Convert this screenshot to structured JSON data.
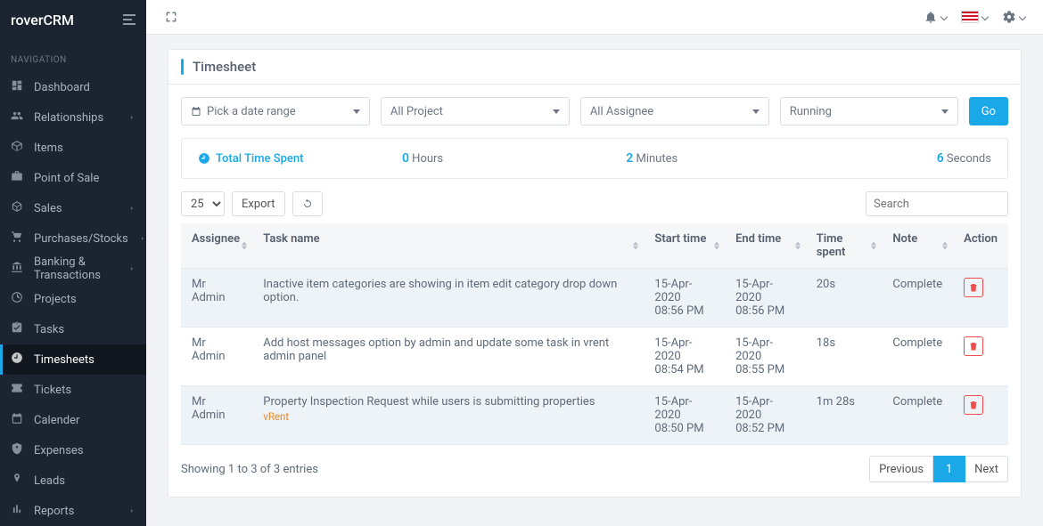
{
  "brand": "roverCRM",
  "nav_heading": "NAVIGATION",
  "sidebar_items": [
    {
      "label": "Dashboard",
      "has_chev": false,
      "active": false
    },
    {
      "label": "Relationships",
      "has_chev": true,
      "active": false
    },
    {
      "label": "Items",
      "has_chev": false,
      "active": false
    },
    {
      "label": "Point of Sale",
      "has_chev": false,
      "active": false
    },
    {
      "label": "Sales",
      "has_chev": true,
      "active": false
    },
    {
      "label": "Purchases/Stocks",
      "has_chev": true,
      "active": false
    },
    {
      "label": "Banking & Transactions",
      "has_chev": true,
      "active": false
    },
    {
      "label": "Projects",
      "has_chev": false,
      "active": false
    },
    {
      "label": "Tasks",
      "has_chev": false,
      "active": false
    },
    {
      "label": "Timesheets",
      "has_chev": false,
      "active": true
    },
    {
      "label": "Tickets",
      "has_chev": false,
      "active": false
    },
    {
      "label": "Calender",
      "has_chev": false,
      "active": false
    },
    {
      "label": "Expenses",
      "has_chev": false,
      "active": false
    },
    {
      "label": "Leads",
      "has_chev": false,
      "active": false
    },
    {
      "label": "Reports",
      "has_chev": true,
      "active": false
    }
  ],
  "page_title": "Timesheet",
  "filters": {
    "date_range": "Pick a date range",
    "project": "All Project",
    "assignee": "All Assignee",
    "status": "Running",
    "go": "Go"
  },
  "summary": {
    "label": "Total Time Spent",
    "hours_n": "0",
    "hours_u": "Hours",
    "minutes_n": "2",
    "minutes_u": "Minutes",
    "seconds_n": "6",
    "seconds_u": "Seconds"
  },
  "toolbar": {
    "page_size": "25",
    "export": "Export",
    "search_ph": "Search"
  },
  "columns": [
    "Assignee",
    "Task name",
    "Start time",
    "End time",
    "Time spent",
    "Note",
    "Action"
  ],
  "rows": [
    {
      "hl": true,
      "assignee": "Mr Admin",
      "task": "Inactive item categories are showing in item edit category drop down option.",
      "task_sub": "",
      "start_d": "15-Apr-2020",
      "start_t": "08:56 PM",
      "end_d": "15-Apr-2020",
      "end_t": "08:56 PM",
      "spent": "20s",
      "note": "Complete"
    },
    {
      "hl": false,
      "assignee": "Mr Admin",
      "task": "Add host messages option by admin and update some task in vrent admin panel",
      "task_sub": "",
      "start_d": "15-Apr-2020",
      "start_t": "08:54 PM",
      "end_d": "15-Apr-2020",
      "end_t": "08:55 PM",
      "spent": "18s",
      "note": "Complete"
    },
    {
      "hl": true,
      "assignee": "Mr Admin",
      "task": "Property Inspection Request while users is submitting properties",
      "task_sub": "vRent",
      "start_d": "15-Apr-2020",
      "start_t": "08:50 PM",
      "end_d": "15-Apr-2020",
      "end_t": "08:52 PM",
      "spent": "1m 28s",
      "note": "Complete"
    }
  ],
  "footer_text": "Showing 1 to 3 of 3 entries",
  "paginate": {
    "prev": "Previous",
    "page": "1",
    "next": "Next"
  }
}
